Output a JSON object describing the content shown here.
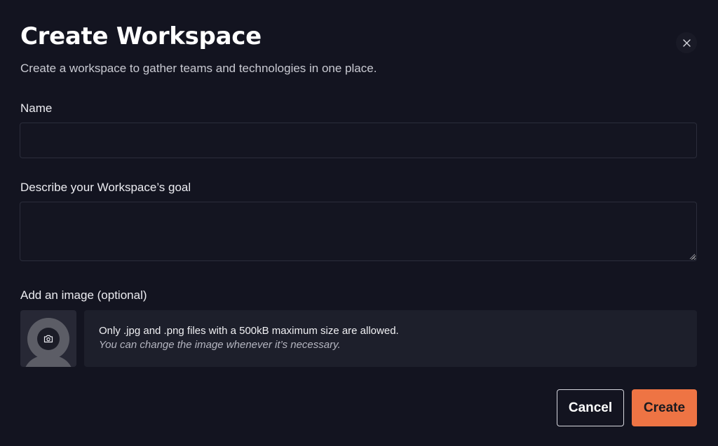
{
  "dialog": {
    "title": "Create Workspace",
    "subtitle": "Create a workspace to gather teams and technologies in one place.",
    "close_icon": "close-icon"
  },
  "form": {
    "name": {
      "label": "Name",
      "value": "",
      "placeholder": ""
    },
    "goal": {
      "label": "Describe your Workspace’s goal",
      "value": "",
      "placeholder": ""
    },
    "image": {
      "label": "Add an image (optional)",
      "placeholder_icon": "avatar-placeholder-icon",
      "upload_icon": "camera-icon",
      "info_line1": "Only .jpg and .png files with a 500kB maximum size are allowed.",
      "info_line2": "You can change the image whenever it’s necessary."
    }
  },
  "actions": {
    "cancel_label": "Cancel",
    "create_label": "Create"
  },
  "colors": {
    "background": "#131420",
    "accent": "#ee7444",
    "panel": "#1d1f2b"
  }
}
